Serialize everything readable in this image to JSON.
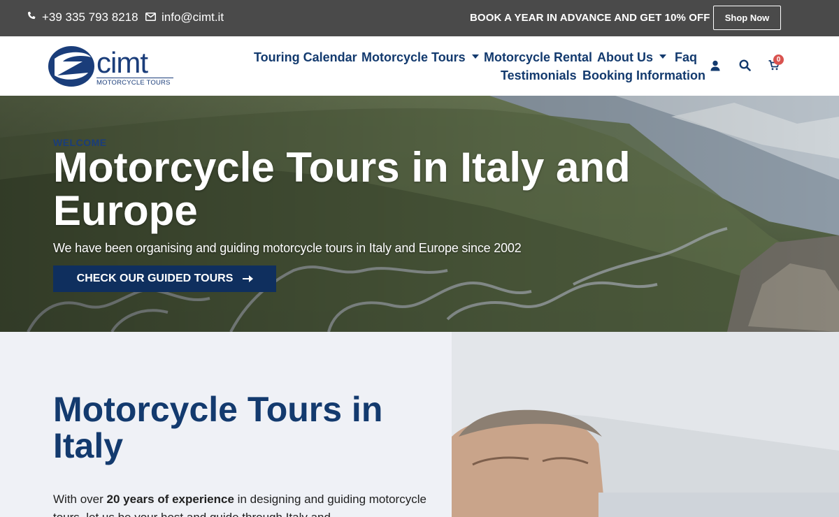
{
  "topbar": {
    "phone": "+39 335 793 8218",
    "email": "info@cimt.it",
    "promo": "BOOK A YEAR IN ADVANCE AND GET 10% OFF",
    "shop_label": "Shop Now"
  },
  "header": {
    "logo_text": "cimt",
    "logo_sub": "MOTORCYCLE TOURS",
    "nav": {
      "touring_calendar": "Touring Calendar",
      "motorcycle_tours": "Motorcycle Tours",
      "motorcycle_rental": "Motorcycle Rental",
      "about_us": "About Us",
      "faq": "Faq",
      "testimonials": "Testimonials",
      "booking_information": "Booking Information"
    },
    "cart_count": "0"
  },
  "hero": {
    "eyebrow": "WELCOME",
    "title": "Motorcycle Tours in Italy and Europe",
    "subtitle": "We have been organising and guiding motorcycle tours in Italy and Europe since 2002",
    "cta_label": "CHECK OUR GUIDED TOURS"
  },
  "intro": {
    "title": "Motorcycle Tours in Italy",
    "text_before": "With over ",
    "text_bold": "20 years of experience",
    "text_after": " in designing and guiding motorcycle tours, let us be your host and guide through Italy and"
  },
  "colors": {
    "brand_navy": "#133a6e",
    "topbar_bg": "#4a4a4a",
    "cta_bg": "#0f2f5e",
    "badge_red": "#d9534f"
  },
  "icons": [
    "phone-icon",
    "envelope-icon",
    "chevron-down-icon",
    "user-icon",
    "search-icon",
    "cart-icon",
    "arrow-right-icon"
  ]
}
